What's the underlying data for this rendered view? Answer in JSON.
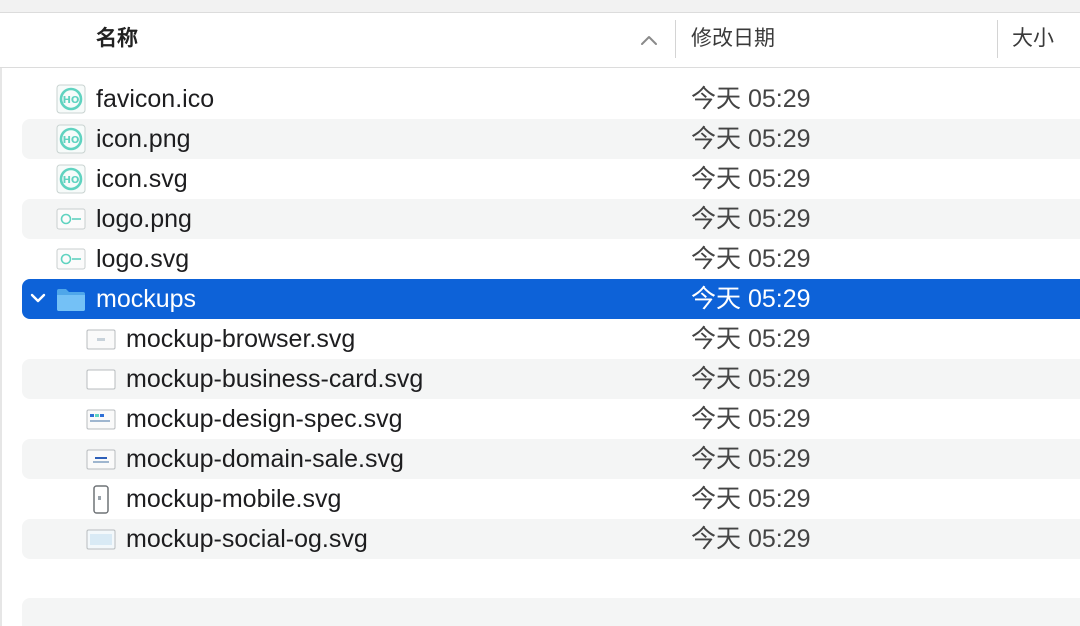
{
  "header": {
    "name": "名称",
    "date_modified": "修改日期",
    "size": "大小"
  },
  "colors": {
    "selection": "#0d62d8",
    "alt_row": "#f4f5f5",
    "icon_teal": "#5fd3c0",
    "folder": "#63b8f2"
  },
  "rows": [
    {
      "name": "favicon.ico",
      "date": "今天 05:29",
      "icon": "app-icon",
      "level": 0
    },
    {
      "name": "icon.png",
      "date": "今天 05:29",
      "icon": "app-icon",
      "level": 0
    },
    {
      "name": "icon.svg",
      "date": "今天 05:29",
      "icon": "app-icon",
      "level": 0
    },
    {
      "name": "logo.png",
      "date": "今天 05:29",
      "icon": "logo-icon",
      "level": 0
    },
    {
      "name": "logo.svg",
      "date": "今天 05:29",
      "icon": "logo-icon",
      "level": 0
    },
    {
      "name": "mockups",
      "date": "今天 05:29",
      "icon": "folder-icon",
      "level": 0,
      "expanded": true,
      "selected": true
    },
    {
      "name": "mockup-browser.svg",
      "date": "今天 05:29",
      "icon": "browser-doc-icon",
      "level": 1
    },
    {
      "name": "mockup-business-card.svg",
      "date": "今天 05:29",
      "icon": "card-doc-icon",
      "level": 1
    },
    {
      "name": "mockup-design-spec.svg",
      "date": "今天 05:29",
      "icon": "spec-doc-icon",
      "level": 1
    },
    {
      "name": "mockup-domain-sale.svg",
      "date": "今天 05:29",
      "icon": "sale-doc-icon",
      "level": 1
    },
    {
      "name": "mockup-mobile.svg",
      "date": "今天 05:29",
      "icon": "phone-icon",
      "level": 1
    },
    {
      "name": "mockup-social-og.svg",
      "date": "今天 05:29",
      "icon": "social-doc-icon",
      "level": 1
    }
  ]
}
